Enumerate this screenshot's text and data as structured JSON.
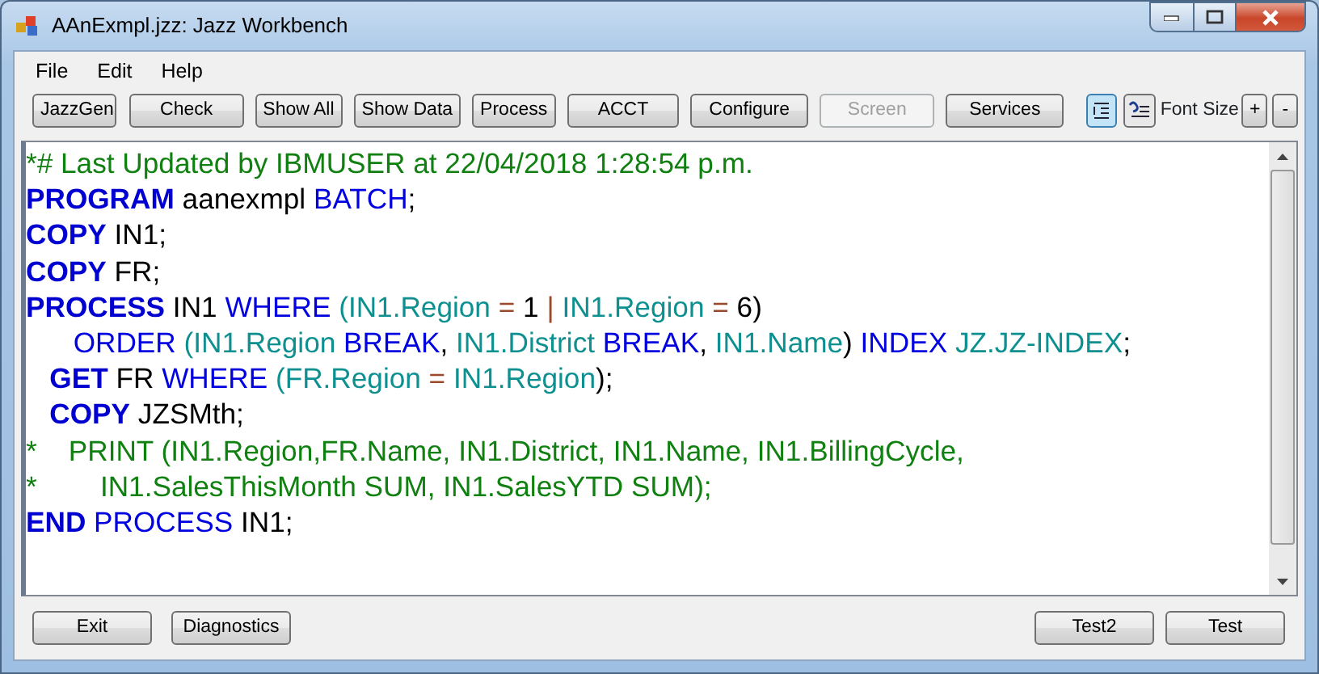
{
  "window": {
    "title": "AAnExmpl.jzz: Jazz Workbench"
  },
  "menu": [
    "File",
    "Edit",
    "Help"
  ],
  "toolbar": [
    {
      "label": "JazzGen",
      "disabled": false
    },
    {
      "label": "Check",
      "disabled": false
    },
    {
      "label": "Show All",
      "disabled": false
    },
    {
      "label": "Show Data",
      "disabled": false
    },
    {
      "label": "Process",
      "disabled": false
    },
    {
      "label": "ACCT",
      "disabled": false
    },
    {
      "label": "Configure",
      "disabled": false
    },
    {
      "label": "Screen",
      "disabled": true
    },
    {
      "label": "Services",
      "disabled": false
    }
  ],
  "view_toggles": [
    {
      "selected": true
    },
    {
      "selected": false
    }
  ],
  "font_size": {
    "label": "Font Size",
    "buttons": [
      "+",
      "-"
    ]
  },
  "editor": {
    "lines": [
      [
        {
          "kind": "comment",
          "text": "*# Last Updated by IBMUSER at 22/04/2018 1:28:54 p.m."
        }
      ],
      [
        {
          "kind": "keyword",
          "text": "PROGRAM"
        },
        {
          "kind": "plain",
          "text": " aanexmpl "
        },
        {
          "kind": "reserved",
          "text": "BATCH"
        },
        {
          "kind": "plain",
          "text": ";"
        }
      ],
      [
        {
          "kind": "keyword",
          "text": "COPY"
        },
        {
          "kind": "plain",
          "text": " IN1;"
        }
      ],
      [
        {
          "kind": "keyword",
          "text": "COPY"
        },
        {
          "kind": "plain",
          "text": " FR;"
        }
      ],
      [
        {
          "kind": "keyword",
          "text": "PROCESS"
        },
        {
          "kind": "plain",
          "text": " IN1 "
        },
        {
          "kind": "reserved",
          "text": "WHERE"
        },
        {
          "kind": "field",
          "text": " (IN1.Region"
        },
        {
          "kind": "operator",
          "text": " = "
        },
        {
          "kind": "plain",
          "text": "1"
        },
        {
          "kind": "operator",
          "text": " | "
        },
        {
          "kind": "field",
          "text": "IN1.Region"
        },
        {
          "kind": "operator",
          "text": " = "
        },
        {
          "kind": "plain",
          "text": "6)"
        }
      ],
      [
        {
          "kind": "reserved",
          "text": "      ORDER"
        },
        {
          "kind": "field",
          "text": " (IN1.Region"
        },
        {
          "kind": "reserved",
          "text": " BREAK"
        },
        {
          "kind": "plain",
          "text": ", "
        },
        {
          "kind": "field",
          "text": "IN1.District"
        },
        {
          "kind": "reserved",
          "text": " BREAK"
        },
        {
          "kind": "plain",
          "text": ", "
        },
        {
          "kind": "field",
          "text": "IN1.Name"
        },
        {
          "kind": "plain",
          "text": ") "
        },
        {
          "kind": "reserved",
          "text": "INDEX"
        },
        {
          "kind": "field",
          "text": " JZ.JZ-INDEX"
        },
        {
          "kind": "plain",
          "text": ";"
        }
      ],
      [
        {
          "kind": "keyword",
          "text": "   GET"
        },
        {
          "kind": "plain",
          "text": " FR "
        },
        {
          "kind": "reserved",
          "text": "WHERE"
        },
        {
          "kind": "field",
          "text": " (FR.Region"
        },
        {
          "kind": "operator",
          "text": " = "
        },
        {
          "kind": "field",
          "text": "IN1.Region"
        },
        {
          "kind": "plain",
          "text": ");"
        }
      ],
      [
        {
          "kind": "keyword",
          "text": "   COPY"
        },
        {
          "kind": "plain",
          "text": " JZSMth;"
        }
      ],
      [
        {
          "kind": "comment",
          "text": "*    PRINT (IN1.Region,FR.Name, IN1.District, IN1.Name, IN1.BillingCycle,"
        }
      ],
      [
        {
          "kind": "comment",
          "text": "*        IN1.SalesThisMonth SUM, IN1.SalesYTD SUM);"
        }
      ],
      [
        {
          "kind": "keyword",
          "text": "END"
        },
        {
          "kind": "reserved",
          "text": " PROCESS"
        },
        {
          "kind": "plain",
          "text": " IN1;"
        }
      ]
    ]
  },
  "bottom_left": [
    "Exit",
    "Diagnostics"
  ],
  "bottom_right": [
    "Test2",
    "Test"
  ]
}
